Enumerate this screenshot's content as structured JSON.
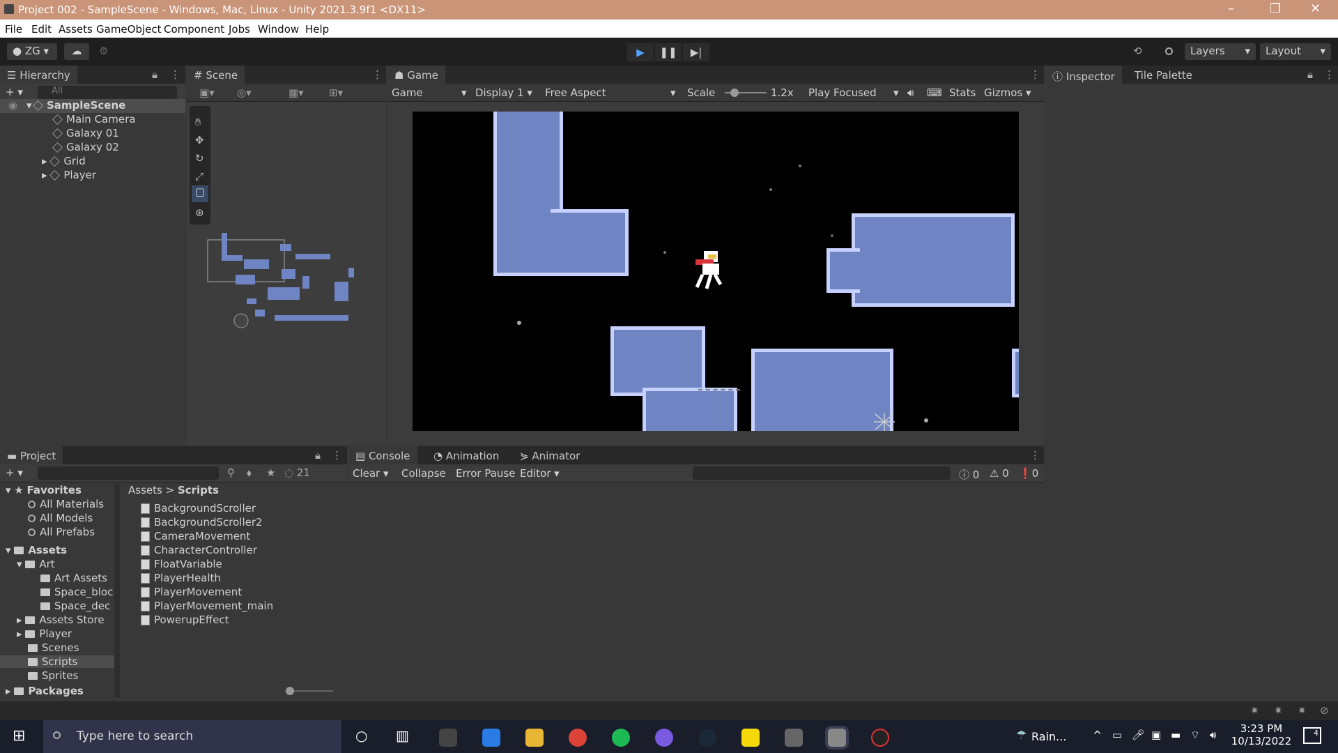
{
  "window": {
    "title": "Project 002 - SampleScene - Windows, Mac, Linux - Unity 2021.3.9f1 <DX11>"
  },
  "menu": [
    "File",
    "Edit",
    "Assets",
    "GameObject",
    "Component",
    "Jobs",
    "Window",
    "Help"
  ],
  "toolbar": {
    "account": "ZG",
    "layers": "Layers",
    "layout": "Layout"
  },
  "hierarchy": {
    "tab": "Hierarchy",
    "search_placeholder": "All",
    "scene": "SampleScene",
    "items": [
      "Main Camera",
      "Galaxy 01",
      "Galaxy 02",
      "Grid",
      "Player"
    ]
  },
  "scene": {
    "tab": "Scene"
  },
  "game": {
    "tab": "Game",
    "mode": "Game",
    "display": "Display 1",
    "aspect": "Free Aspect",
    "scale_label": "Scale",
    "scale_value": "1.2x",
    "play_mode": "Play Focused",
    "stats": "Stats",
    "gizmos": "Gizmos"
  },
  "inspector": {
    "tabs": [
      "Inspector",
      "Tile Palette"
    ]
  },
  "project": {
    "tab": "Project",
    "hidden_count": "21",
    "favorites_label": "Favorites",
    "favorites": [
      "All Materials",
      "All Models",
      "All Prefabs"
    ],
    "assets_label": "Assets",
    "tree": [
      "Art",
      "Art Assets",
      "Space_bloc",
      "Space_dec",
      "Assets Store",
      "Player",
      "Scenes",
      "Scripts",
      "Sprites",
      "Packages"
    ],
    "breadcrumb": [
      "Assets",
      "Scripts"
    ],
    "files": [
      "BackgroundScroller",
      "BackgroundScroller2",
      "CameraMovement",
      "CharacterController",
      "FloatVariable",
      "PlayerHealth",
      "PlayerMovement",
      "PlayerMovement_main",
      "PowerupEffect"
    ]
  },
  "console": {
    "tabs": [
      "Console",
      "Animation",
      "Animator"
    ],
    "clear": "Clear",
    "collapse": "Collapse",
    "error_pause": "Error Pause",
    "editor": "Editor",
    "counts": [
      "0",
      "0",
      "0"
    ]
  },
  "taskbar": {
    "search_placeholder": "Type here to search",
    "weather": "Rain...",
    "time": "3:23 PM",
    "date": "10/13/2022",
    "notifications": "4"
  }
}
